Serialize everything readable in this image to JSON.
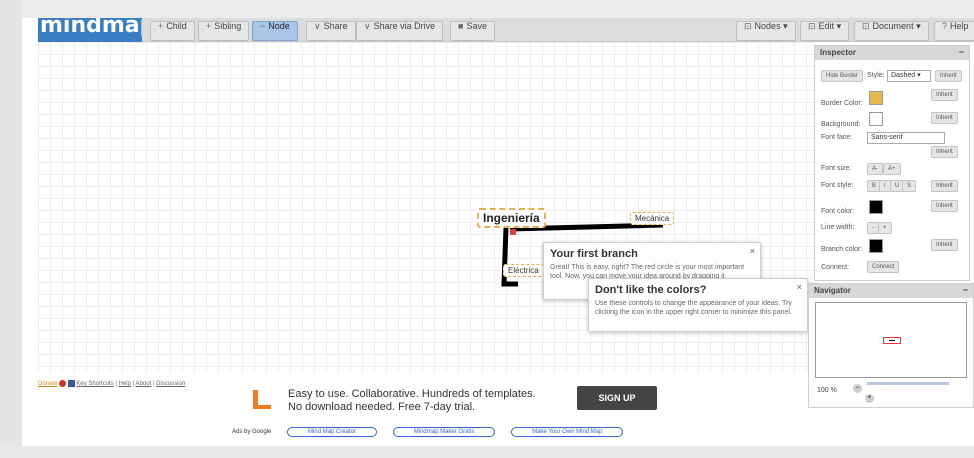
{
  "toolbar": {
    "logo": "mindmaps",
    "child": "Child",
    "sibling": "Sibling",
    "node": "Node",
    "share": "Share",
    "share_drive": "Share via Drive",
    "save": "Save",
    "nodes": "Nodes",
    "edit": "Edit",
    "document": "Document",
    "help": "Help"
  },
  "canvas": {
    "root": "Ingeniería",
    "child_1": "Mecánica",
    "child_2": "Eléctrica"
  },
  "popup_branch": {
    "title": "Your first branch",
    "body": "Great! This is easy, right? The red circle is your most important tool. Now, you can move your idea around by dragging it"
  },
  "popup_colors": {
    "title": "Don't like the colors?",
    "body": "Use these controls to change the appearance of your ideas. Try clicking the icon in the upper right corner to minimize this panel."
  },
  "inspector": {
    "title": "Inspector",
    "hide_border": "Hide Border",
    "style_label": "Style:",
    "style_value": "Dashed",
    "inherit": "Inherit",
    "border_color": "Border Color:",
    "background": "Background:",
    "font_face": "Font face:",
    "font_face_value": "Sans-serif",
    "font_size": "Font size:",
    "font_style": "Font style:",
    "font_color": "Font color:",
    "line_width": "Line width:",
    "branch_color": "Branch color:",
    "connect": "Connect:",
    "connect_btn": "Connect",
    "size_down": "A-",
    "size_up": "A+",
    "style_b": "B",
    "style_i": "I",
    "style_u": "U",
    "style_s": "S",
    "line_minus": "-",
    "line_plus": "+",
    "colors": {
      "border": "#e2b84f",
      "background": "#ffffff",
      "font": "#000000",
      "branch": "#000000"
    }
  },
  "navigator": {
    "title": "Navigator",
    "zoom": "100 %"
  },
  "footer": {
    "donate": "Donate",
    "key_shortcuts": "Key Shortcuts",
    "help": "Help",
    "about": "About",
    "discussion": "Discussion"
  },
  "ad": {
    "line1": "Easy to use. Collaborative. Hundreds of templates.",
    "line2": "No download needed. Free 7-day trial.",
    "cta": "SIGN UP",
    "ads_by": "Ads by Google",
    "link1": "Mind Map Creator",
    "link2": "Mindmap Maker Gratis",
    "link3": "Make Your Own Mind Map"
  }
}
